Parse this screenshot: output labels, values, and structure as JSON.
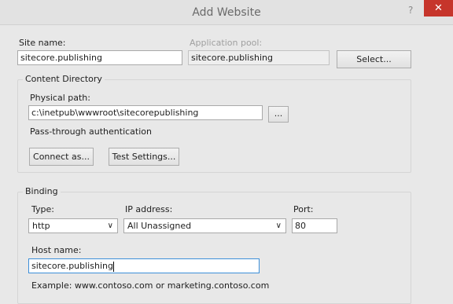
{
  "window": {
    "title": "Add Website",
    "help": "?",
    "close": "✕"
  },
  "site": {
    "label": "Site name:",
    "value": "sitecore.publishing"
  },
  "app_pool": {
    "label": "Application pool:",
    "value": "sitecore.publishing",
    "select_button": "Select..."
  },
  "content": {
    "group_label": "Content Directory",
    "physical_path_label": "Physical path:",
    "physical_path_value": "c:\\inetpub\\wwwroot\\sitecorepublishing",
    "browse_button": "...",
    "passthrough_label": "Pass-through authentication",
    "connect_button": "Connect as...",
    "test_button": "Test Settings..."
  },
  "binding": {
    "group_label": "Binding",
    "type_label": "Type:",
    "type_value": "http",
    "ip_label": "IP address:",
    "ip_value": "All Unassigned",
    "port_label": "Port:",
    "port_value": "80",
    "host_label": "Host name:",
    "host_value": "sitecore.publishing",
    "example": "Example: www.contoso.com or marketing.contoso.com"
  },
  "icons": {
    "dropdown": "chevron-down-icon"
  }
}
